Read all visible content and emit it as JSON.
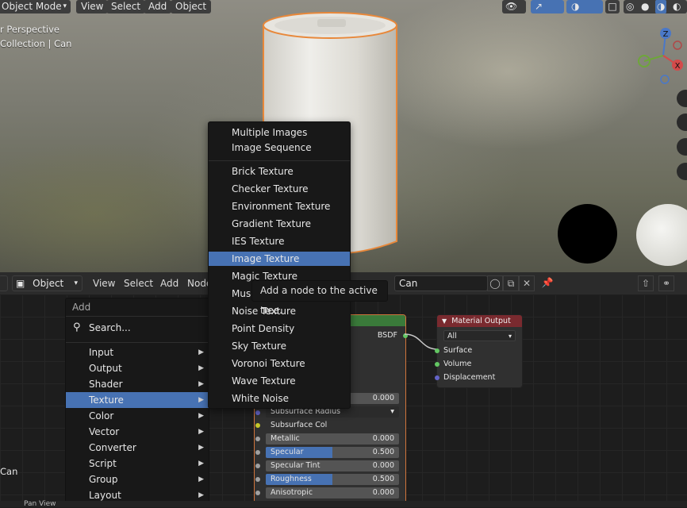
{
  "viewport": {
    "mode_label": "Object Mode",
    "menus": [
      "View",
      "Select",
      "Add",
      "Object"
    ],
    "overlay_line1": "r Perspective",
    "overlay_line2": "Collection | Can",
    "gizmo": {
      "z": "Z",
      "y": "Y",
      "x": "X"
    }
  },
  "node_editor": {
    "object_dropdown": "Object",
    "menus": [
      "View",
      "Select",
      "Add",
      "Node"
    ],
    "material_name": "Can",
    "bottom_left_label": "Can"
  },
  "bsdf_node": {
    "output_label": "BSDF",
    "props": [
      {
        "label": "",
        "value": "0.000"
      },
      {
        "label": "Subsurface Radius",
        "value": ""
      },
      {
        "label": "Subsurface Col",
        "value": ""
      },
      {
        "label": "Metallic",
        "value": "0.000"
      },
      {
        "label": "Specular",
        "value": "0.500",
        "fill": 0.5
      },
      {
        "label": "Specular Tint",
        "value": "0.000"
      },
      {
        "label": "Roughness",
        "value": "0.500",
        "fill": 0.5
      },
      {
        "label": "Anisotropic",
        "value": "0.000"
      }
    ]
  },
  "material_output": {
    "title": "Material Output",
    "target": "All",
    "sockets": [
      "Surface",
      "Volume",
      "Displacement"
    ]
  },
  "add_menu": {
    "title": "Add",
    "search_label": "Search...",
    "items": [
      "Input",
      "Output",
      "Shader",
      "Texture",
      "Color",
      "Vector",
      "Converter",
      "Script",
      "Group",
      "Layout"
    ],
    "active": "Texture"
  },
  "texture_menu": {
    "group1": [
      "Multiple Images",
      "Image Sequence"
    ],
    "group2": [
      "Brick Texture",
      "Checker Texture",
      "Environment Texture",
      "Gradient Texture",
      "IES Texture",
      "Image Texture",
      "Magic Texture",
      "Musgrave Texture",
      "Noise Texture",
      "Point Density",
      "Sky Texture",
      "Voronoi Texture",
      "Wave Texture",
      "White Noise"
    ],
    "active": "Image Texture"
  },
  "tooltip": "Add a node to the active tree.",
  "statusbar": {
    "label": "Pan View"
  },
  "colors": {
    "accent": "#4772b3",
    "selection_outline": "#e8883a",
    "bsdf_header": "#3a7a3a",
    "output_header": "#7a2a2f"
  }
}
